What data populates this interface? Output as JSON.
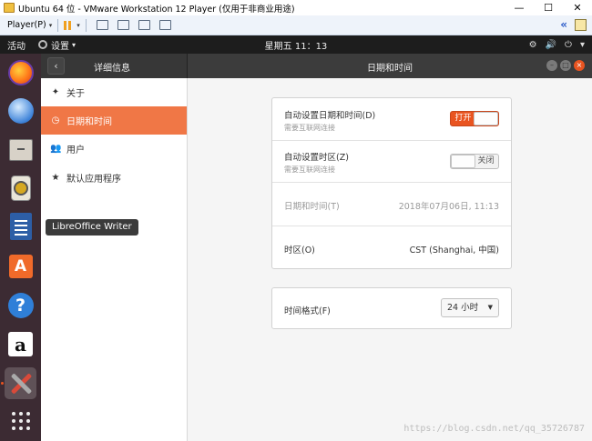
{
  "window": {
    "title": "Ubuntu 64 位 - VMware Workstation 12 Player (仅用于非商业用途)",
    "controls": {
      "minimize": "—",
      "maximize": "☐",
      "close": "✕"
    }
  },
  "vmware_toolbar": {
    "player_label": "Player(P)",
    "caret": "▾",
    "pause_icon": "pause-icon",
    "collapse_icon": "«"
  },
  "top_panel": {
    "activities": "活动",
    "settings_menu": "设置",
    "settings_caret": "▾",
    "clock": "星期五 11：13",
    "tray": {
      "network": "⚙",
      "volume": "🔊",
      "power": "⏻",
      "menu": "▾"
    }
  },
  "dock": {
    "items": [
      "Firefox",
      "Thunderbird",
      "Files",
      "Rhythmbox",
      "LibreOffice Writer",
      "Ubuntu Software",
      "Help",
      "Amazon",
      "Settings",
      "Show Applications"
    ],
    "store_letter": "A",
    "help_symbol": "?",
    "amazon_letter": "a",
    "tooltip": "LibreOffice Writer"
  },
  "settings_header": {
    "left_title": "详细信息",
    "back_symbol": "‹",
    "right_title": "日期和时间"
  },
  "sidebar": {
    "items": [
      {
        "icon": "✦",
        "label": "关于"
      },
      {
        "icon": "◷",
        "label": "日期和时间"
      },
      {
        "icon": "👥",
        "label": "用户"
      },
      {
        "icon": "★",
        "label": "默认应用程序"
      }
    ]
  },
  "main": {
    "auto_datetime": {
      "title": "自动设置日期和时间(D)",
      "subtitle": "需要互联网连接",
      "switch_label": "打开",
      "state": "on"
    },
    "auto_timezone": {
      "title": "自动设置时区(Z)",
      "subtitle": "需要互联网连接",
      "switch_label": "关闭",
      "state": "off"
    },
    "datetime": {
      "title": "日期和时间(T)",
      "value": "2018年07月06日, 11:13"
    },
    "timezone": {
      "title": "时区(O)",
      "value": "CST (Shanghai, 中国)"
    },
    "time_format": {
      "title": "时间格式(F)",
      "value": "24 小时",
      "arrow": "▼"
    }
  },
  "watermark": "https://blog.csdn.net/qq_35726787",
  "colors": {
    "accent": "#e95420",
    "sidebar_selected": "#f07746",
    "dock": "#3c2b33",
    "panel": "#1d1d1d"
  }
}
